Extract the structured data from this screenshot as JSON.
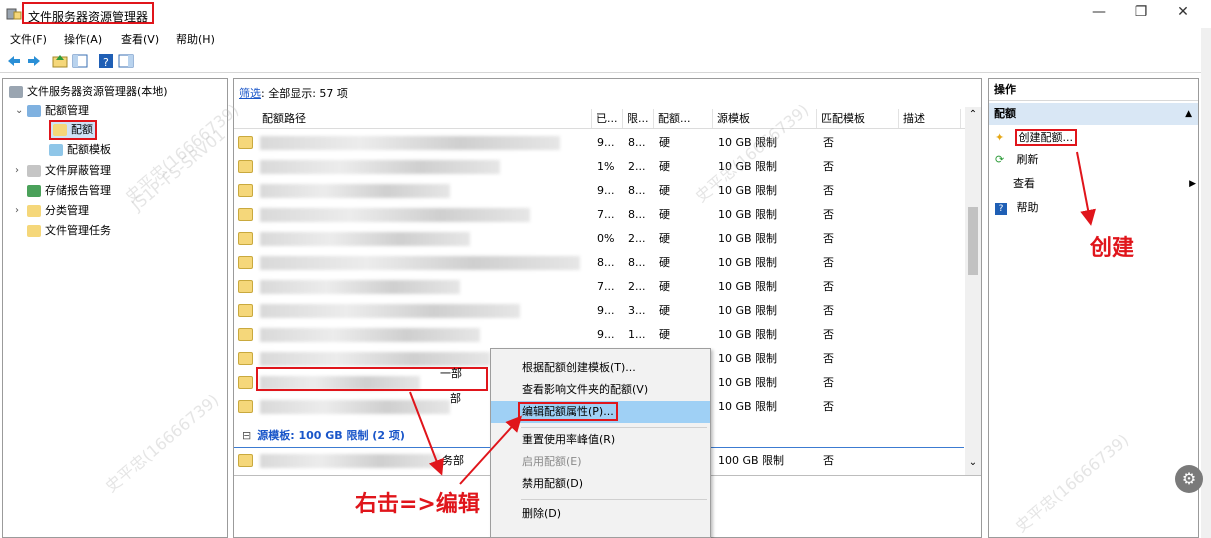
{
  "window": {
    "title": "文件服务器资源管理器",
    "controls": [
      "—",
      "❐",
      "✕"
    ]
  },
  "menu": [
    "文件(F)",
    "操作(A)",
    "查看(V)",
    "帮助(H)"
  ],
  "tree": {
    "root": "文件服务器资源管理器(本地)",
    "quota_mgmt": "配额管理",
    "quota": "配额",
    "quota_template": "配额模板",
    "file_screen": "文件屏蔽管理",
    "storage_reports": "存储报告管理",
    "classification": "分类管理",
    "file_tasks": "文件管理任务"
  },
  "center": {
    "filter_link": "筛选",
    "filter_text": ": 全部显示: 57 项",
    "columns": [
      "配额路径",
      "已...",
      "限...",
      "配额...",
      "源模板",
      "匹配模板",
      "描述"
    ],
    "rows": [
      {
        "used": "9...",
        "limit": "8...",
        "type": "硬",
        "template": "10 GB 限制",
        "match": "否"
      },
      {
        "used": "1%",
        "limit": "2...",
        "type": "硬",
        "template": "10 GB 限制",
        "match": "否"
      },
      {
        "used": "9...",
        "limit": "8...",
        "type": "硬",
        "template": "10 GB 限制",
        "match": "否"
      },
      {
        "used": "7...",
        "limit": "8...",
        "type": "硬",
        "template": "10 GB 限制",
        "match": "否"
      },
      {
        "used": "0%",
        "limit": "2...",
        "type": "硬",
        "template": "10 GB 限制",
        "match": "否"
      },
      {
        "used": "8...",
        "limit": "8...",
        "type": "硬",
        "template": "10 GB 限制",
        "match": "否"
      },
      {
        "used": "7...",
        "limit": "2...",
        "type": "硬",
        "template": "10 GB 限制",
        "match": "否"
      },
      {
        "used": "9...",
        "limit": "3...",
        "type": "硬",
        "template": "10 GB 限制",
        "match": "否"
      },
      {
        "used": "9...",
        "limit": "1...",
        "type": "硬",
        "template": "10 GB 限制",
        "match": "否"
      },
      {
        "used": "",
        "limit": "",
        "type": "",
        "template": "10 GB 限制",
        "match": "否"
      },
      {
        "used": "",
        "limit": "",
        "type": "",
        "template": "10 GB 限制",
        "match": "否",
        "path_tail": "一部"
      },
      {
        "used": "",
        "limit": "",
        "type": "",
        "template": "10 GB 限制",
        "match": "否",
        "path_tail": "部"
      }
    ],
    "group_label": "源模板: 100 GB 限制 (2 项)",
    "group_row": {
      "path_tail": "务部",
      "template": "100 GB 限制",
      "match": "否"
    }
  },
  "context_menu": {
    "items": [
      "根据配额创建模板(T)...",
      "查看影响文件夹的配额(V)",
      "编辑配额属性(P)...",
      "重置使用率峰值(R)",
      "启用配额(E)",
      "禁用配额(D)",
      "删除(D)"
    ]
  },
  "actions": {
    "header": "操作",
    "section": "配额",
    "create": "创建配额...",
    "refresh": "刷新",
    "view": "查看",
    "help": "帮助"
  },
  "annotations": {
    "create_label": "创建",
    "edit_label": "右击=>编辑"
  },
  "watermarks": [
    "史平忠(16666739)",
    "JS1P-FS-SRV01"
  ]
}
